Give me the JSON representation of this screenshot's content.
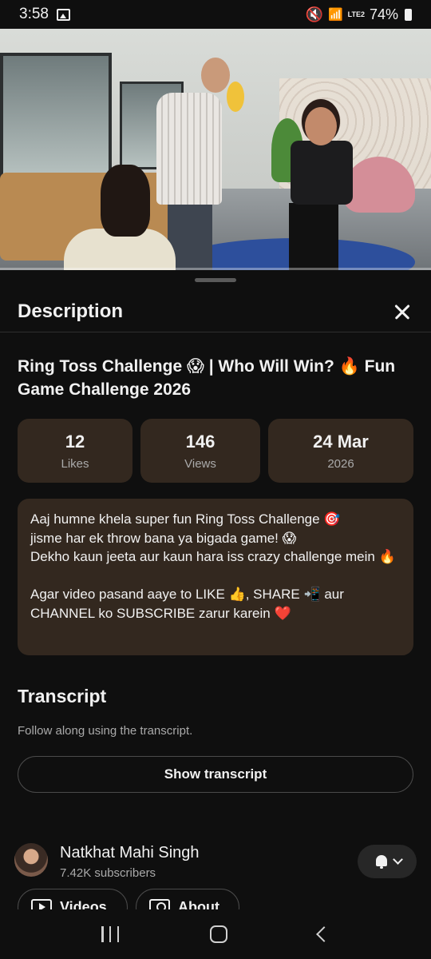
{
  "status_bar": {
    "time": "3:58",
    "network": "LTE2",
    "battery": "74%"
  },
  "video": {
    "progress_fraction": 0.0
  },
  "sheet": {
    "title": "Description",
    "video_title": "Ring Toss Challenge 😱 | Who Will Win? 🔥 Fun Game Challenge 2026",
    "stats": [
      {
        "value": "12",
        "label": "Likes"
      },
      {
        "value": "146",
        "label": "Views"
      },
      {
        "value": "24 Mar",
        "label": "2026"
      }
    ],
    "description": "Aaj humne khela super fun Ring Toss Challenge 🎯\njisme har ek throw bana ya bigada game! 😱\nDekho kaun jeeta aur kaun hara iss crazy challenge mein 🔥\n\nAgar video pasand aaye to LIKE 👍, SHARE 📲 aur CHANNEL ko SUBSCRIBE zarur karein ❤️"
  },
  "transcript": {
    "title": "Transcript",
    "subtitle": "Follow along using the transcript.",
    "button_label": "Show transcript"
  },
  "channel": {
    "name": "Natkhat Mahi Singh",
    "subscribers": "7.42K subscribers",
    "chips": [
      "Videos",
      "About"
    ]
  },
  "colors": {
    "background": "#0f0f0f",
    "card": "#33281f",
    "accent": "#ff0033"
  }
}
